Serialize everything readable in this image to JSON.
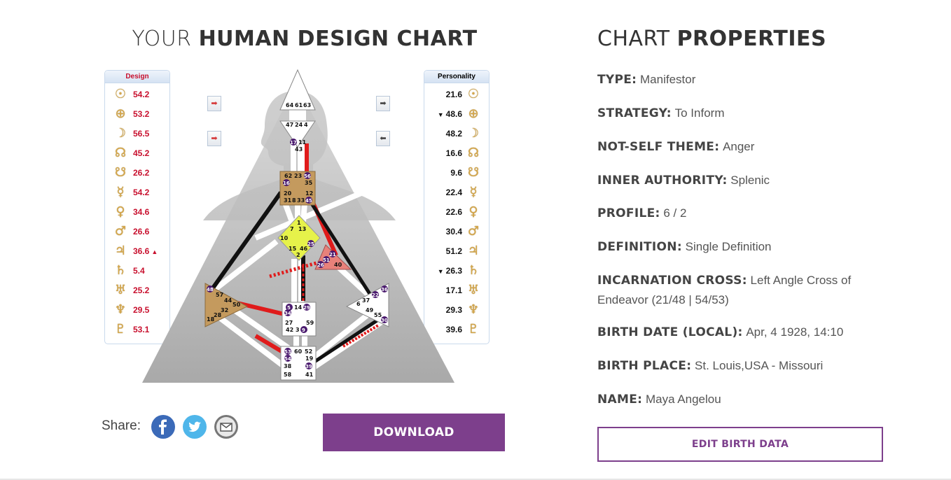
{
  "header": {
    "chart_title_light": "YOUR",
    "chart_title_bold": "HUMAN DESIGN CHART",
    "props_title_light": "CHART",
    "props_title_bold": "PROPERTIES"
  },
  "design": {
    "label": "Design",
    "color": "#c8102e",
    "rows": [
      {
        "planet": "sun-icon",
        "glyph": "☉",
        "value": "54.2",
        "mark": ""
      },
      {
        "planet": "earth-icon",
        "glyph": "⊕",
        "value": "53.2",
        "mark": ""
      },
      {
        "planet": "moon-icon",
        "glyph": "☽",
        "value": "56.5",
        "mark": ""
      },
      {
        "planet": "north-node-icon",
        "glyph": "☊",
        "value": "45.2",
        "mark": ""
      },
      {
        "planet": "south-node-icon",
        "glyph": "☋",
        "value": "26.2",
        "mark": ""
      },
      {
        "planet": "mercury-icon",
        "glyph": "☿",
        "value": "54.2",
        "mark": ""
      },
      {
        "planet": "venus-icon",
        "glyph": "♀",
        "value": "34.6",
        "mark": ""
      },
      {
        "planet": "mars-icon",
        "glyph": "♂",
        "value": "26.6",
        "mark": ""
      },
      {
        "planet": "jupiter-icon",
        "glyph": "♃",
        "value": "36.6",
        "mark": "▲"
      },
      {
        "planet": "saturn-icon",
        "glyph": "♄",
        "value": "5.4",
        "mark": ""
      },
      {
        "planet": "uranus-icon",
        "glyph": "♅",
        "value": "25.2",
        "mark": ""
      },
      {
        "planet": "neptune-icon",
        "glyph": "♆",
        "value": "29.5",
        "mark": ""
      },
      {
        "planet": "pluto-icon",
        "glyph": "♇",
        "value": "53.1",
        "mark": ""
      }
    ]
  },
  "personality": {
    "label": "Personality",
    "rows": [
      {
        "planet": "sun-icon",
        "glyph": "☉",
        "value": "21.6",
        "mark": ""
      },
      {
        "planet": "earth-icon",
        "glyph": "⊕",
        "value": "48.6",
        "mark": "▼"
      },
      {
        "planet": "moon-icon",
        "glyph": "☽",
        "value": "48.2",
        "mark": ""
      },
      {
        "planet": "north-node-icon",
        "glyph": "☊",
        "value": "16.6",
        "mark": ""
      },
      {
        "planet": "south-node-icon",
        "glyph": "☋",
        "value": "9.6",
        "mark": ""
      },
      {
        "planet": "mercury-icon",
        "glyph": "☿",
        "value": "22.4",
        "mark": ""
      },
      {
        "planet": "venus-icon",
        "glyph": "♀",
        "value": "22.6",
        "mark": ""
      },
      {
        "planet": "mars-icon",
        "glyph": "♂",
        "value": "30.4",
        "mark": ""
      },
      {
        "planet": "jupiter-icon",
        "glyph": "♃",
        "value": "51.2",
        "mark": ""
      },
      {
        "planet": "saturn-icon",
        "glyph": "♄",
        "value": "26.3",
        "mark": "▼"
      },
      {
        "planet": "uranus-icon",
        "glyph": "♅",
        "value": "17.1",
        "mark": ""
      },
      {
        "planet": "neptune-icon",
        "glyph": "♆",
        "value": "29.3",
        "mark": ""
      },
      {
        "planet": "pluto-icon",
        "glyph": "♇",
        "value": "39.6",
        "mark": ""
      }
    ]
  },
  "arrows": {
    "left_top": "➡",
    "left_bottom": "➡",
    "right_top": "➡",
    "right_bottom": "⬅"
  },
  "bodygraph": {
    "center_fill": "#ffffff",
    "defined_g_color": "#e6f24a",
    "defined_throat_color": "#c49a5e",
    "defined_heart_color": "#e8817a",
    "purple": "#4a1a6e",
    "red": "#e01b1b",
    "gates": {
      "head": [
        "64",
        "61",
        "63"
      ],
      "ajna_top": [
        "47",
        "24",
        "4"
      ],
      "ajna_bottom": [
        "17",
        "11",
        "43"
      ],
      "throat": [
        "62",
        "23",
        "56",
        "16",
        "35",
        "20",
        "12",
        "31",
        "8",
        "33",
        "45"
      ],
      "g": [
        "1",
        "7",
        "13",
        "10",
        "25",
        "15",
        "46",
        "2"
      ],
      "heart": [
        "21",
        "51",
        "26",
        "40"
      ],
      "spleen": [
        "48",
        "57",
        "44",
        "50",
        "32",
        "28",
        "18"
      ],
      "sacral": [
        "5",
        "14",
        "29",
        "34",
        "27",
        "59",
        "42",
        "3",
        "9"
      ],
      "solar": [
        "36",
        "37",
        "22",
        "6",
        "49",
        "55",
        "30"
      ],
      "root": [
        "53",
        "60",
        "52",
        "54",
        "19",
        "38",
        "39",
        "58",
        "41"
      ]
    }
  },
  "properties": [
    {
      "key": "TYPE:",
      "value": "Manifestor"
    },
    {
      "key": "STRATEGY:",
      "value": "To Inform"
    },
    {
      "key": "NOT-SELF THEME:",
      "value": "Anger"
    },
    {
      "key": "INNER AUTHORITY:",
      "value": "Splenic"
    },
    {
      "key": "PROFILE:",
      "value": "6 / 2"
    },
    {
      "key": "DEFINITION:",
      "value": "Single Definition"
    },
    {
      "key": "INCARNATION CROSS:",
      "value": "Left Angle Cross of Endeavor (21/48 | 54/53)"
    },
    {
      "key": "BIRTH DATE (LOCAL):",
      "value": "Apr, 4 1928, 14:10"
    },
    {
      "key": "BIRTH PLACE:",
      "value": "St. Louis,USA - Missouri"
    },
    {
      "key": "NAME:",
      "value": "Maya Angelou"
    }
  ],
  "share": {
    "label": "Share:",
    "facebook": "facebook-icon",
    "twitter": "twitter-icon",
    "email": "email-icon"
  },
  "buttons": {
    "download": "DOWNLOAD",
    "edit": "EDIT BIRTH DATA"
  }
}
